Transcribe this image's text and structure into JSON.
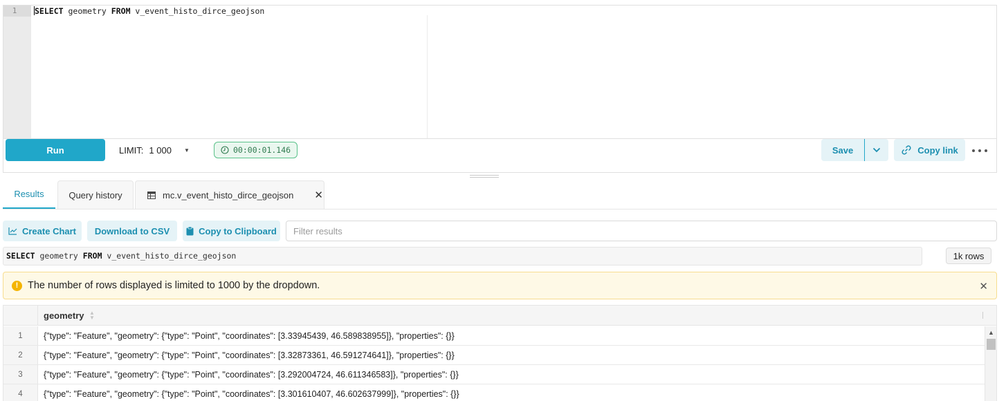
{
  "editor": {
    "line_number": "1",
    "query_keyword_select": "SELECT",
    "query_columns": " geometry ",
    "query_keyword_from": "FROM",
    "query_table": " v_event_histo_dirce_geojson"
  },
  "toolbar": {
    "run_label": "Run",
    "limit_label": "LIMIT:",
    "limit_value": "1 000",
    "timer": "00:00:01.146",
    "save_label": "Save",
    "copy_link_label": "Copy link"
  },
  "tabs": [
    {
      "label": "Results"
    },
    {
      "label": "Query history"
    },
    {
      "label": "mc.v_event_histo_dirce_geojson"
    }
  ],
  "actions": {
    "create_chart": "Create Chart",
    "download_csv": "Download to CSV",
    "copy_clipboard": "Copy to Clipboard",
    "filter_placeholder": "Filter results"
  },
  "executed_sql": {
    "keyword_select": "SELECT",
    "columns": " geometry ",
    "keyword_from": "FROM",
    "table": " v_event_histo_dirce_geojson"
  },
  "rows_badge": "1k rows",
  "alert": {
    "icon": "!",
    "message": "The number of rows displayed is limited to 1000 by the dropdown."
  },
  "table": {
    "column": "geometry",
    "rows": [
      {
        "n": "1",
        "value": "{\"type\": \"Feature\", \"geometry\": {\"type\": \"Point\", \"coordinates\": [3.33945439, 46.589838955]}, \"properties\": {}}"
      },
      {
        "n": "2",
        "value": "{\"type\": \"Feature\", \"geometry\": {\"type\": \"Point\", \"coordinates\": [3.32873361, 46.591274641]}, \"properties\": {}}"
      },
      {
        "n": "3",
        "value": "{\"type\": \"Feature\", \"geometry\": {\"type\": \"Point\", \"coordinates\": [3.292004724, 46.611346583]}, \"properties\": {}}"
      },
      {
        "n": "4",
        "value": "{\"type\": \"Feature\", \"geometry\": {\"type\": \"Point\", \"coordinates\": [3.301610407, 46.602637999]}, \"properties\": {}}"
      }
    ]
  },
  "colors": {
    "primary": "#20a7c9",
    "primary_light": "#e5f3f7",
    "timer_green": "#59c189",
    "alert_bg": "#fef9e6",
    "alert_icon": "#f4b400"
  }
}
